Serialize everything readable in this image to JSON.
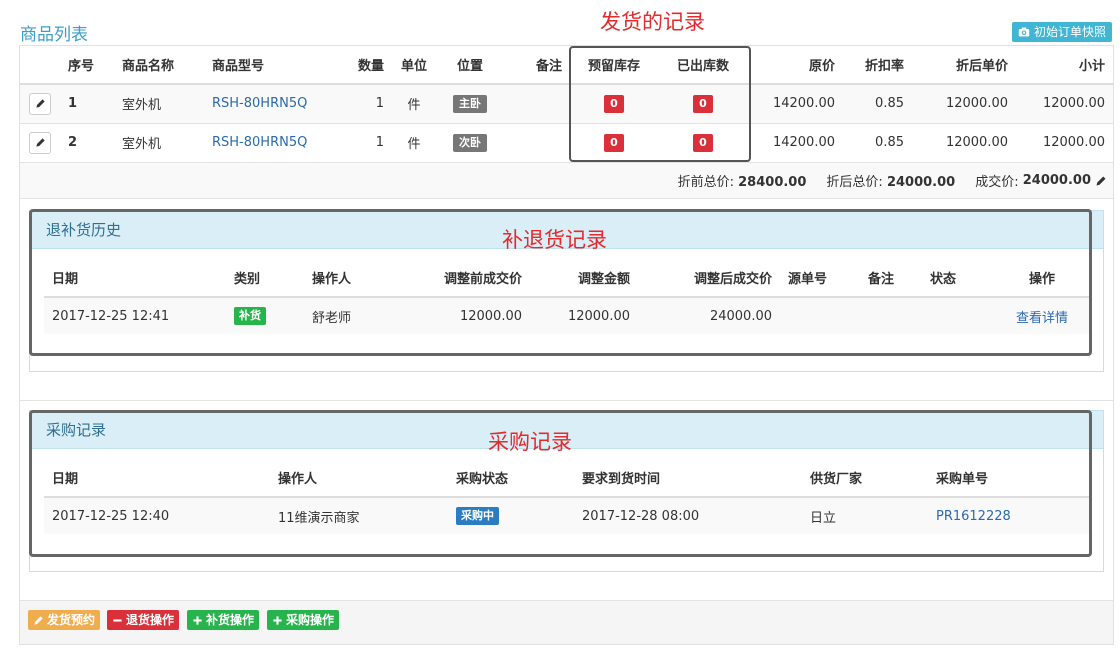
{
  "page_title": "商品列表",
  "snapshot_button": "初始订单快照",
  "annotations": {
    "shipping": "发货的记录",
    "return_restock": "补退货记录",
    "purchase": "采购记录"
  },
  "goods_table": {
    "headers": [
      "序号",
      "商品名称",
      "商品型号",
      "数量",
      "单位",
      "位置",
      "备注",
      "预留库存",
      "已出库数",
      "原价",
      "折扣率",
      "折后单价",
      "小计"
    ],
    "rows": [
      {
        "index": "1",
        "name": "室外机",
        "model": "RSH-80HRN5Q",
        "qty": "1",
        "unit": "件",
        "location": "主卧",
        "note": "",
        "reserved": "0",
        "shipped": "0",
        "price": "14200.00",
        "discount": "0.85",
        "unit_after": "12000.00",
        "subtotal": "12000.00"
      },
      {
        "index": "2",
        "name": "室外机",
        "model": "RSH-80HRN5Q",
        "qty": "1",
        "unit": "件",
        "location": "次卧",
        "note": "",
        "reserved": "0",
        "shipped": "0",
        "price": "14200.00",
        "discount": "0.85",
        "unit_after": "12000.00",
        "subtotal": "12000.00"
      }
    ]
  },
  "totals": {
    "before_label": "折前总价:",
    "before_value": "28400.00",
    "after_label": "折后总价:",
    "after_value": "24000.00",
    "deal_label": "成交价:",
    "deal_value": "24000.00"
  },
  "return_history": {
    "title": "退补货历史",
    "headers": [
      "日期",
      "类别",
      "操作人",
      "调整前成交价",
      "调整金额",
      "调整后成交价",
      "源单号",
      "备注",
      "状态",
      "操作"
    ],
    "rows": [
      {
        "date": "2017-12-25 12:41",
        "type": "补货",
        "operator": "舒老师",
        "before": "12000.00",
        "amount": "12000.00",
        "after": "24000.00",
        "source": "",
        "note": "",
        "status": "",
        "action": "查看详情"
      }
    ]
  },
  "purchase_records": {
    "title": "采购记录",
    "headers": [
      "日期",
      "操作人",
      "采购状态",
      "要求到货时间",
      "供货厂家",
      "采购单号"
    ],
    "rows": [
      {
        "date": "2017-12-25 12:40",
        "operator": "11维演示商家",
        "status": "采购中",
        "required": "2017-12-28 08:00",
        "supplier": "日立",
        "order_no": "PR1612228"
      }
    ]
  },
  "footer_buttons": {
    "ship": "发货预约",
    "return": "退货操作",
    "restock": "补货操作",
    "purchase": "采购操作"
  },
  "colors": {
    "accent": "#3a9fc7",
    "danger": "#d9303a",
    "success": "#28b44c",
    "warning": "#f0ad4e",
    "primary": "#2a7dc1",
    "annotation": "#e32b2b"
  }
}
